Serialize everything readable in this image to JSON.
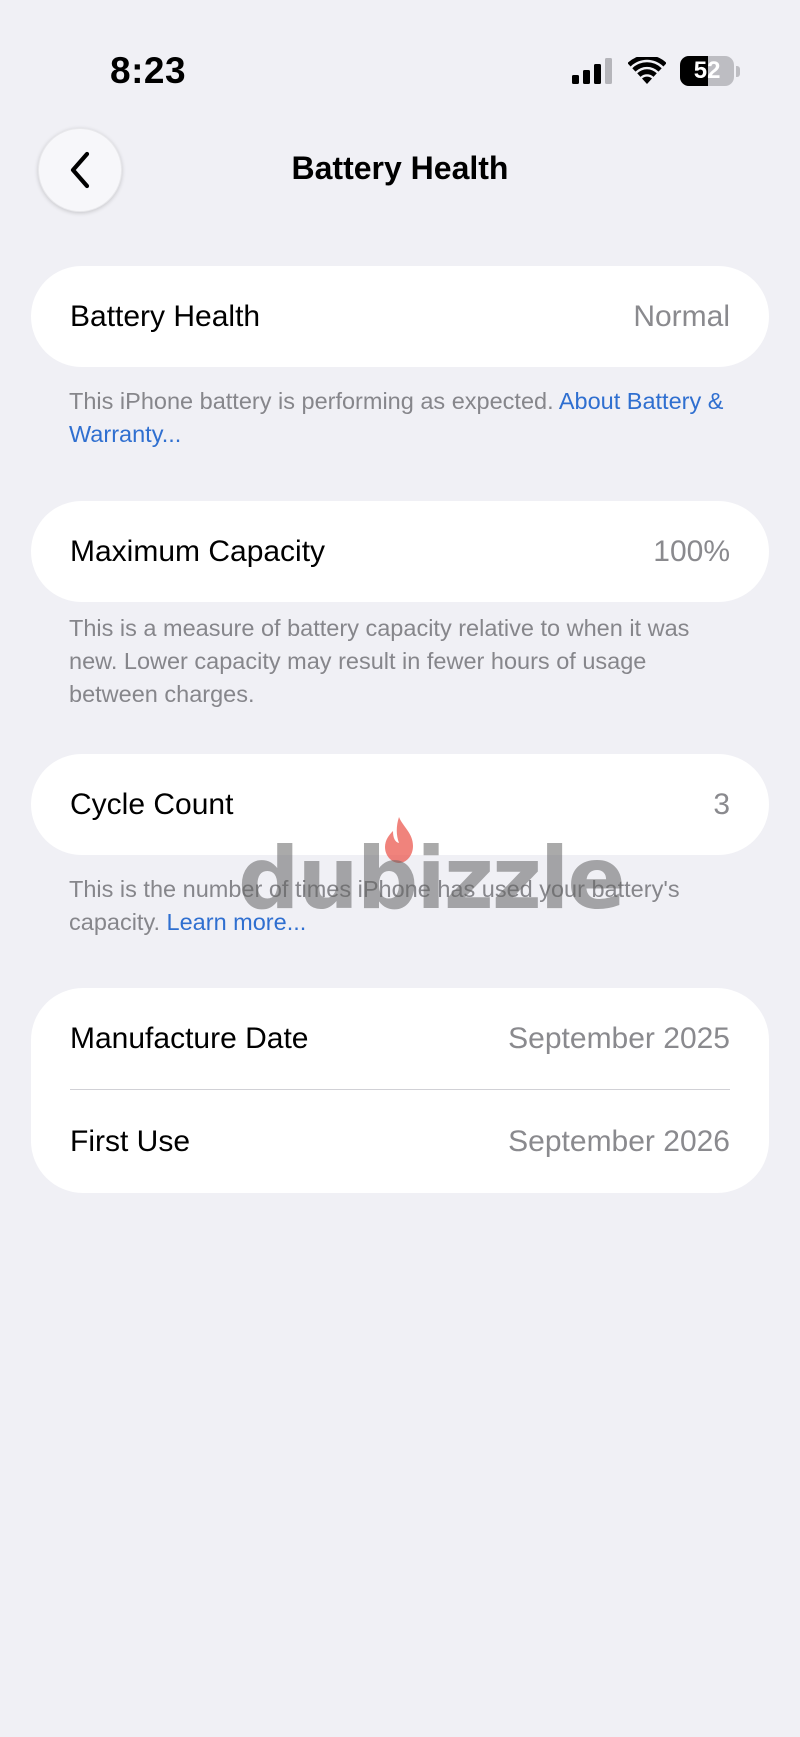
{
  "status_bar": {
    "time": "8:23",
    "battery_level": 52,
    "battery_text": "52"
  },
  "nav": {
    "title": "Battery Health"
  },
  "battery_health": {
    "label": "Battery Health",
    "value": "Normal",
    "note": "This iPhone battery is performing as expected. ",
    "link": "About Battery & Warranty..."
  },
  "max_capacity": {
    "label": "Maximum Capacity",
    "value": "100%",
    "note": "This is a measure of battery capacity relative to when it was new. Lower capacity may result in fewer hours of usage between charges."
  },
  "cycle_count": {
    "label": "Cycle Count",
    "value": "3",
    "note": "This is the number of times iPhone has used your battery's capacity. ",
    "link": "Learn more..."
  },
  "dates": {
    "manufacture_label": "Manufacture Date",
    "manufacture_value": "September 2025",
    "first_use_label": "First Use",
    "first_use_value": "September 2026"
  },
  "watermark": {
    "text": "dubizzle"
  },
  "colors": {
    "background": "#f0f0f5",
    "link": "#2f6fd0",
    "secondary": "#8a8a8e"
  }
}
